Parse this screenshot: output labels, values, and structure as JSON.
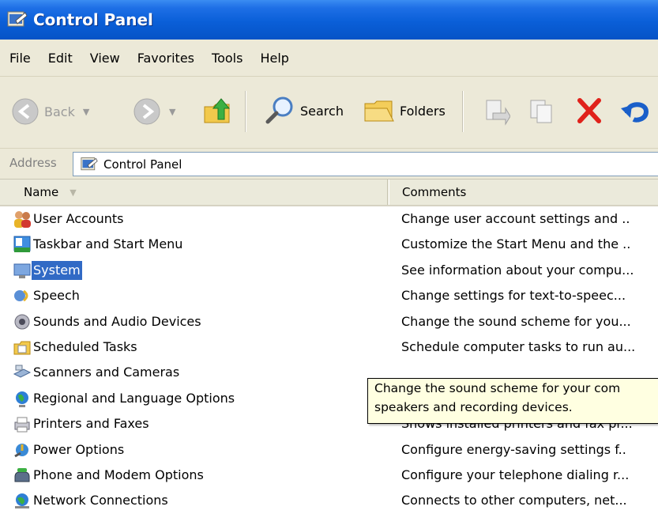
{
  "window": {
    "title": "Control Panel"
  },
  "menu": [
    "File",
    "Edit",
    "View",
    "Favorites",
    "Tools",
    "Help"
  ],
  "toolbar": {
    "back_label": "Back",
    "search_label": "Search",
    "folders_label": "Folders"
  },
  "address": {
    "label": "Address",
    "value": "Control Panel"
  },
  "columns": {
    "name": "Name",
    "comments": "Comments"
  },
  "items": [
    {
      "name": "User Accounts",
      "comment": "Change user account settings and ..",
      "icon": "user-accounts-icon"
    },
    {
      "name": "Taskbar and Start Menu",
      "comment": "Customize the Start Menu and the ..",
      "icon": "taskbar-icon"
    },
    {
      "name": "System",
      "comment": "See information about your compu...",
      "icon": "system-icon",
      "selected": true
    },
    {
      "name": "Speech",
      "comment": "Change settings for text-to-speec...",
      "icon": "speech-icon"
    },
    {
      "name": "Sounds and Audio Devices",
      "comment": "Change the sound scheme for you...",
      "icon": "sounds-icon"
    },
    {
      "name": "Scheduled Tasks",
      "comment": "Schedule computer tasks to run au...",
      "icon": "scheduled-tasks-icon"
    },
    {
      "name": "Scanners and Cameras",
      "comment": "",
      "icon": "scanners-icon"
    },
    {
      "name": "Regional and Language Options",
      "comment": "",
      "icon": "globe-icon"
    },
    {
      "name": "Printers and Faxes",
      "comment": "Shows installed printers and fax pr...",
      "icon": "printer-icon"
    },
    {
      "name": "Power Options",
      "comment": "Configure energy-saving settings f..",
      "icon": "power-icon"
    },
    {
      "name": "Phone and Modem Options",
      "comment": "Configure your telephone dialing r...",
      "icon": "phone-icon"
    },
    {
      "name": "Network Connections",
      "comment": "Connects to other computers, net...",
      "icon": "network-icon"
    }
  ],
  "tooltip": {
    "line1": "Change the sound scheme for your com",
    "line2": "speakers and recording devices."
  },
  "colors": {
    "titlebar": "#0a5fd8",
    "selection": "#316ac5",
    "tooltip_bg": "#ffffe1",
    "chrome_bg": "#ece9d8"
  }
}
